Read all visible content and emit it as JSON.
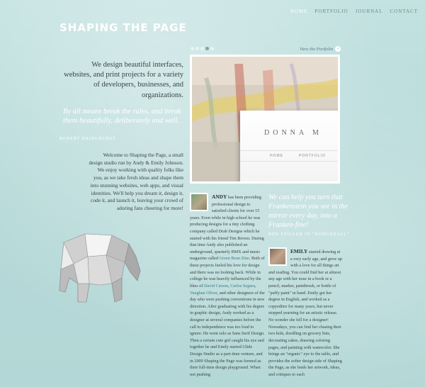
{
  "nav": {
    "items": [
      "HOME",
      "PORTFOLIO",
      "JOURNAL",
      "CONTACT"
    ],
    "active": "HOME"
  },
  "site_title": "SHAPING THE PAGE",
  "intro": "We design beautiful interfaces, websites, and print projects for a variety of developers, businesses, and organizations.",
  "quote": {
    "text": "By all means break the rules, and break them beautifully, deliberately and well.",
    "attribution": "ROBERT BRINGHURST"
  },
  "welcome": "Welcome to Shaping the Page, a small design studio run by Andy & Emily Johnson. We enjoy working with quality folks like you, as we take fresh ideas and shape them into stunning websites, web apps, and visual identities. We'll help you dream it, design it, code it, and launch it, leaving your crowd of adoring fans cheering for more!",
  "slideshow": {
    "dots": 5,
    "active_dot": 3,
    "view_link": "View the Portfolio",
    "preview_logo": "DONNA M",
    "preview_nav": [
      "HOME",
      "PORTFOLIO"
    ]
  },
  "andy": {
    "name": "ANDY",
    "text_1": " has been providing professional design to satisfied clients for over 15 years. Even while in high school he was producing designs for a tiny clothing company called Drab Designs which he started with his friend Tim Brown. During that time Andy also published an underground, quarterly BMX and music magazine called ",
    "link_1": "Green Bean Zine",
    "text_2": ". Both of these projects fueled his love for design and there was no looking back. While in college he was heavily influenced by the likes of ",
    "link_2": "David Carson",
    "sep_1": ", ",
    "link_3": "Carlos Segura",
    "sep_2": ", ",
    "link_4": "Vaughan Oliver",
    "text_3": ", and other designers of the day who were pushing conventions in new direction. After graduating with his degree in graphic design, Andy worked as a designer at several companies before the call to independence was too loud to ignore. He went solo as Sans Serif Design. Then a certain cute girl caught his eye and together he and Emily started Glide Design Studio as a part-time venture, and in 2009 Shaping the Page was formed as their full-time design playground. When not pushing"
  },
  "pull_quote": {
    "text": "We can help you turn that Frankenstein you see in the mirror every day, into a Franken-fine!",
    "attribution": "BEN STILLER IN \"DODGEBALL\""
  },
  "emily": {
    "name": "EMILY",
    "text": " started drawing at a very early age, and grew up with a love for all things art and reading. You could find her at almost any age with her nose in a book or a pencil, marker, paintbrush, or bottle of \"puffy paint\" in hand. Emily got her degree in English, and worked as a copyeditor for many years, but never stopped yearning for an artistic release. No wonder she fell for a designer! Nowadays, you can find her chasing their two kids, doodling on grocery lists, decorating cakes, drawing coloring pages, and painting with watercolor. She brings an \"organic\" eye to the table, and provides the softer design side of Shaping the Page, as she lends her artwork, ideas, and critiques to each"
  },
  "colors": {
    "background": "#b9dcdb",
    "link": "#3c7a86",
    "white_text": "#ffffff"
  },
  "icons": [
    "elephant-illustration",
    "arrow-right-icon"
  ]
}
